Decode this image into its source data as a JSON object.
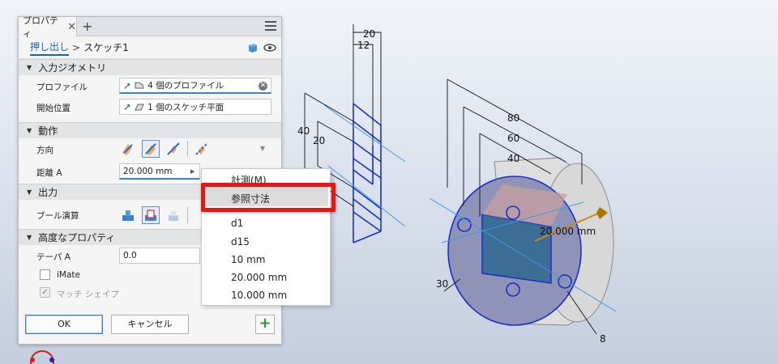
{
  "panel": {
    "tab_label": "プロパティ",
    "tab_close": "✕",
    "tab_add": "+",
    "breadcrumb": {
      "link": "押し出し",
      "separator": ">",
      "current": "スケッチ1"
    },
    "sections": {
      "input_geometry": "入力ジオメトリ",
      "behavior": "動作",
      "output": "出力",
      "advanced": "高度なプロパティ"
    },
    "profile": {
      "label": "プロファイル",
      "value": "4 個のプロファイル"
    },
    "start_position": {
      "label": "開始位置",
      "value": "1 個のスケッチ平面"
    },
    "direction": {
      "label": "方向"
    },
    "distance": {
      "label": "距離 A",
      "value": "20.000 mm"
    },
    "boolean": {
      "label": "ブール演算"
    },
    "taper": {
      "label": "テーパ A",
      "value": "0.0"
    },
    "imate": {
      "label": "iMate",
      "checked": false
    },
    "match_shape": {
      "label": "マッチ シェイプ",
      "checked": true,
      "disabled": true
    },
    "buttons": {
      "ok": "OK",
      "cancel": "キャンセル",
      "add": "+"
    }
  },
  "popup_menu": {
    "items": [
      "計測(M)",
      "参照寸法",
      "d1",
      "d15",
      "10 mm",
      "20.000 mm",
      "10.000 mm"
    ],
    "highlighted": "参照寸法"
  },
  "viewport": {
    "dims": [
      "20",
      "12",
      "40",
      "20",
      "80",
      "60",
      "40",
      "20.000 mm",
      "30",
      "8"
    ]
  },
  "colors": {
    "accent": "#1a66c2",
    "highlight_frame": "#e21717",
    "sketch_blue": "#1a2fc9"
  }
}
